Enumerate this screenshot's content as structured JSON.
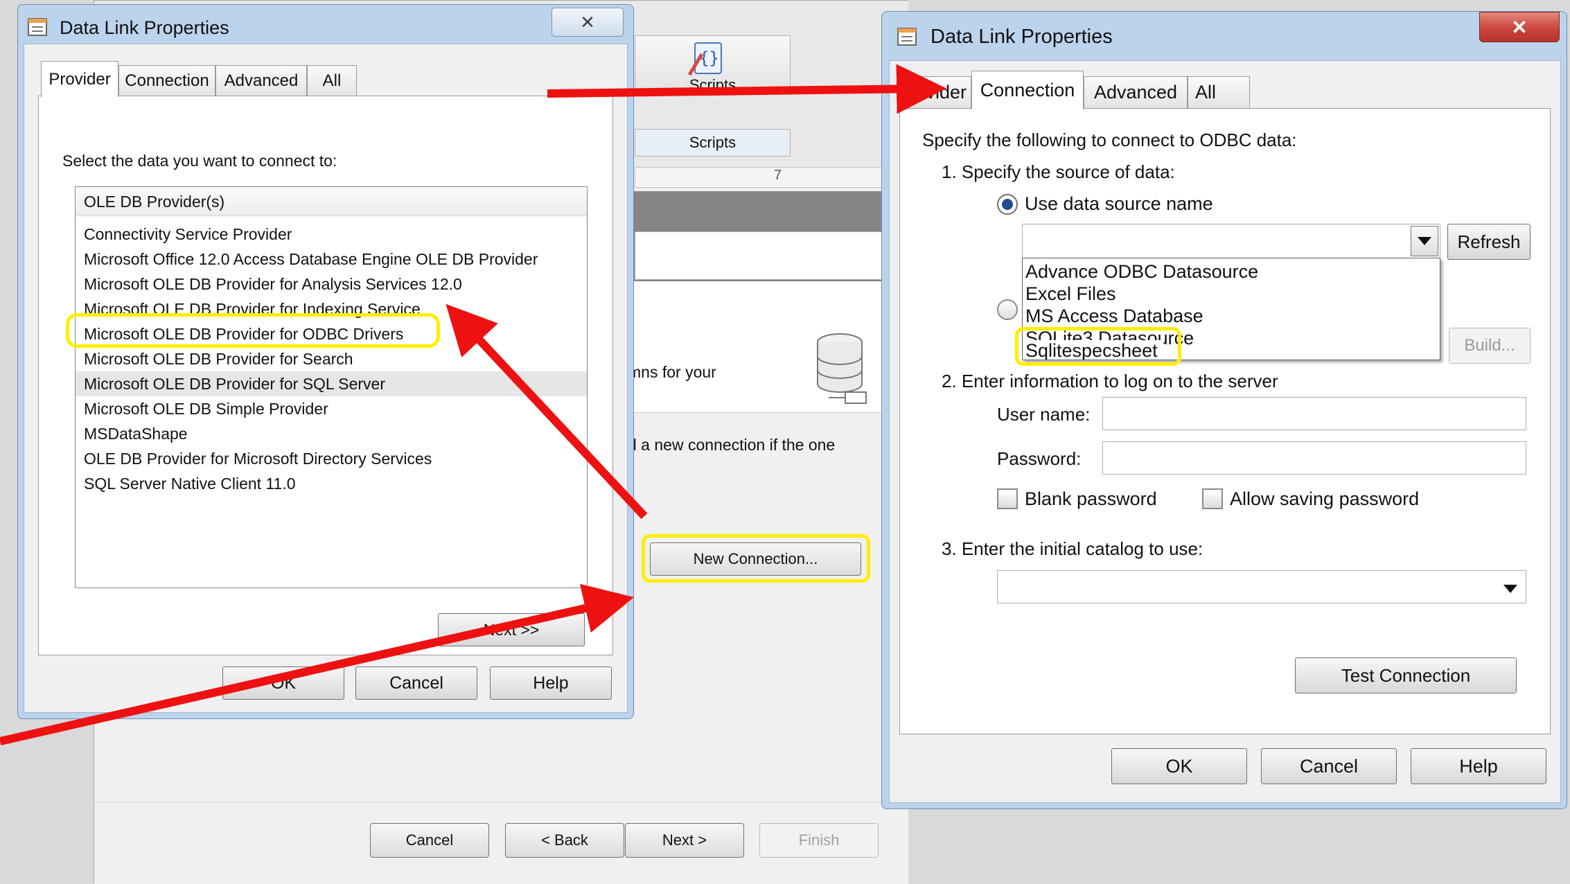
{
  "wizard": {
    "scripts_button_label": "Scripts",
    "scripts_group_label": "Scripts",
    "ruler_mark": "7",
    "banner_fragment": "mns for your",
    "body_fragment": "d a new connection if the one",
    "new_connection_label": "New Connection...",
    "cancel_label": "Cancel",
    "back_label": "< Back",
    "next_label": "Next >",
    "finish_label": "Finish"
  },
  "left_dialog": {
    "title": "Data Link Properties",
    "close_glyph": "✕",
    "tabs": [
      "Provider",
      "Connection",
      "Advanced",
      "All"
    ],
    "active_tab": "Provider",
    "prompt": "Select the data you want to connect to:",
    "list_header": "OLE DB Provider(s)",
    "providers": [
      "Connectivity Service Provider",
      "Microsoft Office 12.0 Access Database Engine OLE DB Provider",
      "Microsoft OLE DB Provider for Analysis Services 12.0",
      "Microsoft OLE DB Provider for Indexing Service",
      "Microsoft OLE DB Provider for ODBC Drivers",
      "Microsoft OLE DB Provider for Search",
      "Microsoft OLE DB Provider for SQL Server",
      "Microsoft OLE DB Simple Provider",
      "MSDataShape",
      "OLE DB Provider for Microsoft Directory Services",
      "SQL Server Native Client 11.0"
    ],
    "selected_provider": "Microsoft OLE DB Provider for SQL Server",
    "highlighted_provider": "Microsoft OLE DB Provider for ODBC Drivers",
    "next_label": "Next >>",
    "ok_label": "OK",
    "cancel_label": "Cancel",
    "help_label": "Help"
  },
  "right_dialog": {
    "title": "Data Link Properties",
    "close_glyph": "✕",
    "tabs": [
      "rovider",
      "Connection",
      "Advanced",
      "All"
    ],
    "active_tab": "Connection",
    "intro": "Specify the following to connect to ODBC data:",
    "step1": "1. Specify the source of data:",
    "use_dsn_label": "Use data source name",
    "dsn_value": "",
    "dsn_options": [
      "Advance ODBC Datasource",
      "Excel Files",
      "MS Access Database",
      "SQLite3 Datasource",
      "Sqlitespecsheet"
    ],
    "highlighted_dsn": "Sqlitespecsheet",
    "refresh_label": "Refresh",
    "build_label": "Build...",
    "step2": "2. Enter information to log on to the server",
    "username_label": "User name:",
    "username_value": "",
    "password_label": "Password:",
    "password_value": "",
    "blank_password_label": "Blank password",
    "allow_saving_label": "Allow saving password",
    "step3": "3. Enter the initial catalog to use:",
    "catalog_value": "",
    "test_connection_label": "Test Connection",
    "ok_label": "OK",
    "cancel_label": "Cancel",
    "help_label": "Help"
  },
  "colors": {
    "highlight": "#ffee00",
    "arrow": "#ee1111",
    "close_button_red": "#c9463d",
    "title_bar": "#bcd3ec"
  }
}
